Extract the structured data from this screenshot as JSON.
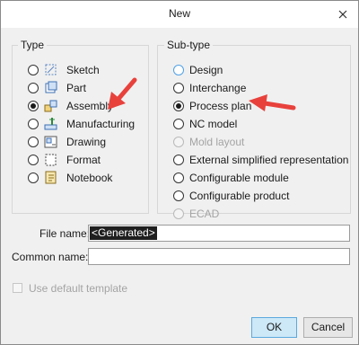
{
  "dialog": {
    "title": "New",
    "close_glyph": "✕"
  },
  "type_group": {
    "title": "Type",
    "items": [
      {
        "label": "Sketch",
        "icon": "sketch-icon",
        "checked": false
      },
      {
        "label": "Part",
        "icon": "part-icon",
        "checked": false
      },
      {
        "label": "Assembly",
        "icon": "assembly-icon",
        "checked": true
      },
      {
        "label": "Manufacturing",
        "icon": "manufacturing-icon",
        "checked": false
      },
      {
        "label": "Drawing",
        "icon": "drawing-icon",
        "checked": false
      },
      {
        "label": "Format",
        "icon": "format-icon",
        "checked": false
      },
      {
        "label": "Notebook",
        "icon": "notebook-icon",
        "checked": false
      }
    ]
  },
  "subtype_group": {
    "title": "Sub-type",
    "items": [
      {
        "label": "Design",
        "checked": false,
        "disabled": false
      },
      {
        "label": "Interchange",
        "checked": false,
        "disabled": false
      },
      {
        "label": "Process plan",
        "checked": true,
        "disabled": false
      },
      {
        "label": "NC model",
        "checked": false,
        "disabled": false
      },
      {
        "label": "Mold layout",
        "checked": false,
        "disabled": true
      },
      {
        "label": "External simplified representation",
        "checked": false,
        "disabled": false
      },
      {
        "label": "Configurable module",
        "checked": false,
        "disabled": false
      },
      {
        "label": "Configurable product",
        "checked": false,
        "disabled": false
      },
      {
        "label": "ECAD",
        "checked": false,
        "disabled": true
      }
    ]
  },
  "file_name": {
    "label": "File name:",
    "value": "<Generated>"
  },
  "common_name": {
    "label": "Common name:",
    "value": ""
  },
  "template": {
    "label": "Use default template",
    "checked": false,
    "disabled": true
  },
  "buttons": {
    "ok": "OK",
    "cancel": "Cancel"
  },
  "colors": {
    "annotation_arrow": "#e8413c",
    "ok_button_fill": "#cde8f7",
    "focus_ring": "#4ea1e6"
  }
}
